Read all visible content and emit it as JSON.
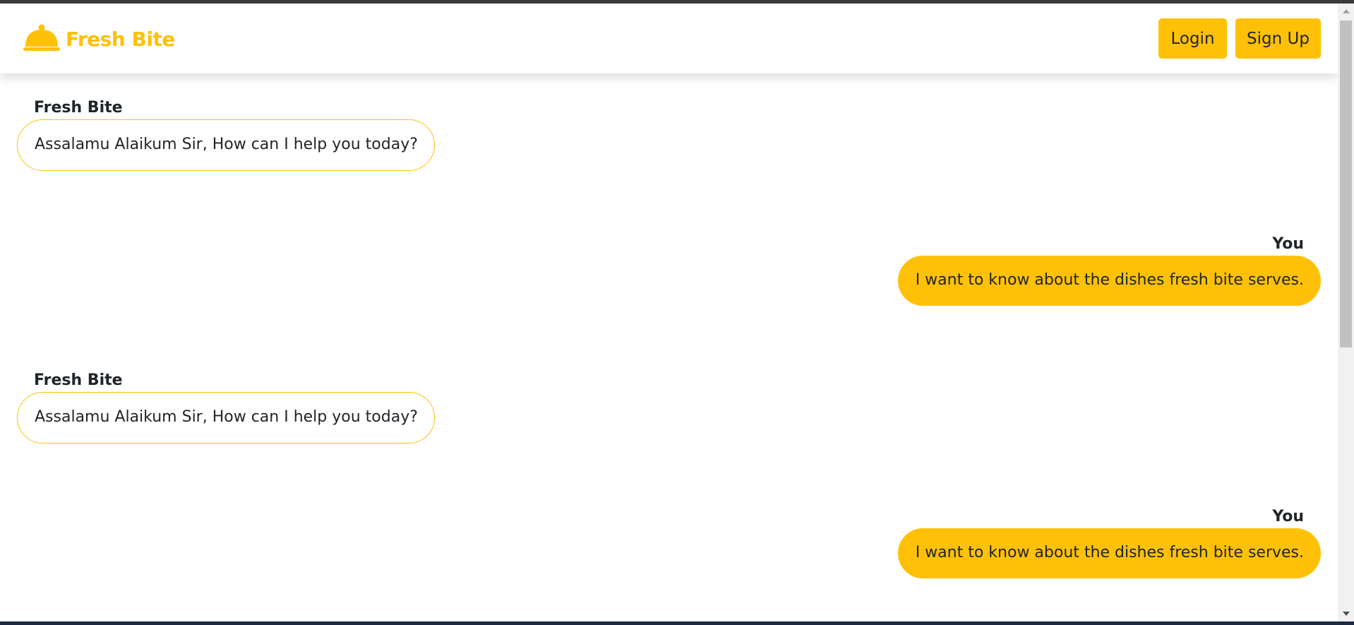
{
  "brand": {
    "name": "Fresh Bite",
    "icon": "cloche-icon",
    "color": "#ffc107"
  },
  "nav": {
    "login_label": "Login",
    "signup_label": "Sign Up"
  },
  "colors": {
    "accent": "#ffc107",
    "text": "#212529"
  },
  "messages": [
    {
      "sender": "Fresh Bite",
      "text": "Assalamu Alaikum Sir, How can I help you today?",
      "from": "bot"
    },
    {
      "sender": "You",
      "text": "I want to know about the dishes fresh bite serves.",
      "from": "user"
    },
    {
      "sender": "Fresh Bite",
      "text": "Assalamu Alaikum Sir, How can I help you today?",
      "from": "bot"
    },
    {
      "sender": "You",
      "text": "I want to know about the dishes fresh bite serves.",
      "from": "user"
    }
  ]
}
